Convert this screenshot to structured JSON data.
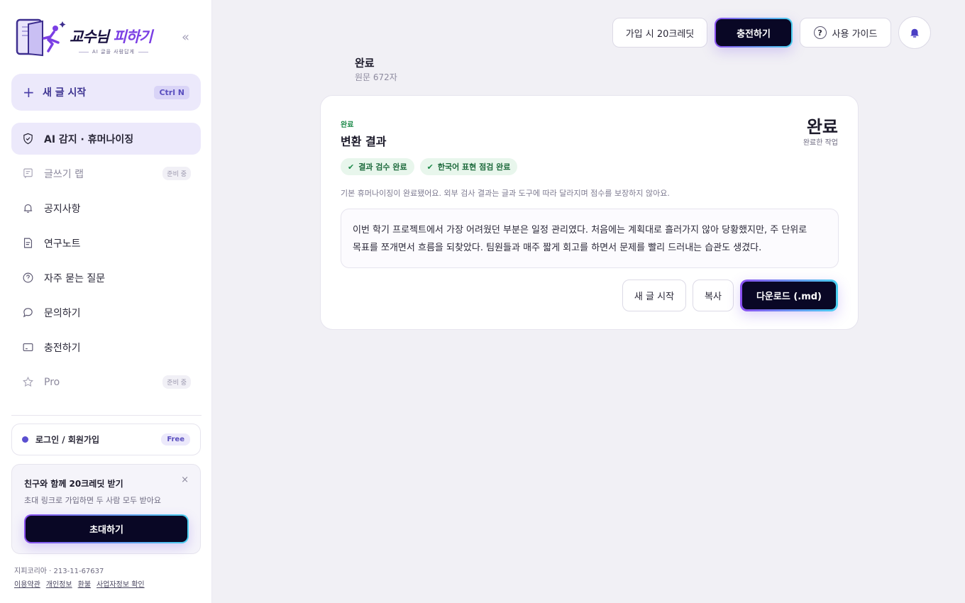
{
  "brand": {
    "name_part1": "교수님 ",
    "name_part2": "피하기",
    "tagline": "AI 글을 사람답게",
    "collapse": "«"
  },
  "sidebar": {
    "new_button": {
      "label": "새 글 시작",
      "shortcut": "Ctrl N"
    },
    "items": [
      {
        "label": "AI 감지 · 휴머나이징",
        "icon": "shield-icon",
        "active": true
      },
      {
        "label": "글쓰기 랩",
        "icon": "message-square-icon",
        "tag": "준비 중"
      },
      {
        "label": "공지사항",
        "icon": "bell-icon"
      },
      {
        "label": "연구노트",
        "icon": "document-icon"
      },
      {
        "label": "자주 묻는 질문",
        "icon": "help-circle-icon"
      },
      {
        "label": "문의하기",
        "icon": "chat-bubble-icon"
      },
      {
        "label": "충전하기",
        "icon": "card-icon"
      },
      {
        "label": "Pro",
        "icon": "star-icon",
        "tag": "준비 중"
      }
    ],
    "login": {
      "label": "로그인 / 회원가입",
      "badge": "Free"
    },
    "invite": {
      "title": "친구와 함께 20크레딧 받기",
      "subtitle": "초대 링크로 가입하면 두 사람 모두 받아요",
      "close": "×",
      "button": "초대하기"
    },
    "footer": {
      "company": "지피코리아 · 213-11-67637",
      "links": [
        "이용약관",
        "개인정보",
        "환불",
        "사업자정보 확인"
      ]
    }
  },
  "header": {
    "signup_bonus": "가입 시 20크레딧",
    "charge": "충전하기",
    "guide": "사용 가이드"
  },
  "page": {
    "title": "완료",
    "subtitle": "원문 672자"
  },
  "card": {
    "state": "완료",
    "title": "변환 결과",
    "big_status": "완료",
    "big_sub": "완료한 작업",
    "chips": [
      "결과 검수 완료",
      "한국어 표현 점검 완료"
    ],
    "note": "기본 휴머나이징이 완료됐어요. 외부 검사 결과는 글과 도구에 따라 달라지며 점수를 보장하지 않아요.",
    "result_line1": "이번 학기 프로젝트에서 가장 어려웠던 부분은 일정 관리였다. 처음에는 계획대로 흘러가지 않아 당황했지만, 주 단위로",
    "result_line2": "목표를 쪼개면서 흐름을 되찾았다. 팀원들과 매주 짧게 회고를 하면서 문제를 빨리 드러내는 습관도 생겼다.",
    "actions": {
      "new": "새 글 시작",
      "copy": "복사",
      "download": "다운로드 (.md)"
    }
  },
  "colors": {
    "accent": "#7b3fe4",
    "dark_button": "#090725",
    "success": "#1d8a4a",
    "active_bg": "#ece9fb"
  }
}
